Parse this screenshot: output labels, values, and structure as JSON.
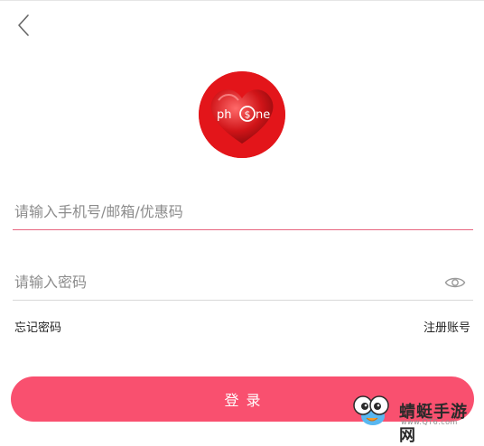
{
  "header": {
    "back_icon": "chevron-left-icon"
  },
  "logo": {
    "text": "phone",
    "background_color": "#e3151a"
  },
  "form": {
    "account_placeholder": "请输入手机号/邮箱/优惠码",
    "password_placeholder": "请输入密码",
    "password_toggle_icon": "eye-icon",
    "forgot_password": "忘记密码",
    "register": "注册账号",
    "login_button": "登录"
  },
  "watermark": {
    "name": "蜻蜓手游网",
    "url": "www.QT6.com"
  },
  "colors": {
    "primary": "#f9506f",
    "active_underline": "#e8657f",
    "inactive_underline": "#d8d8d8",
    "placeholder_text": "#8c8c8c"
  }
}
